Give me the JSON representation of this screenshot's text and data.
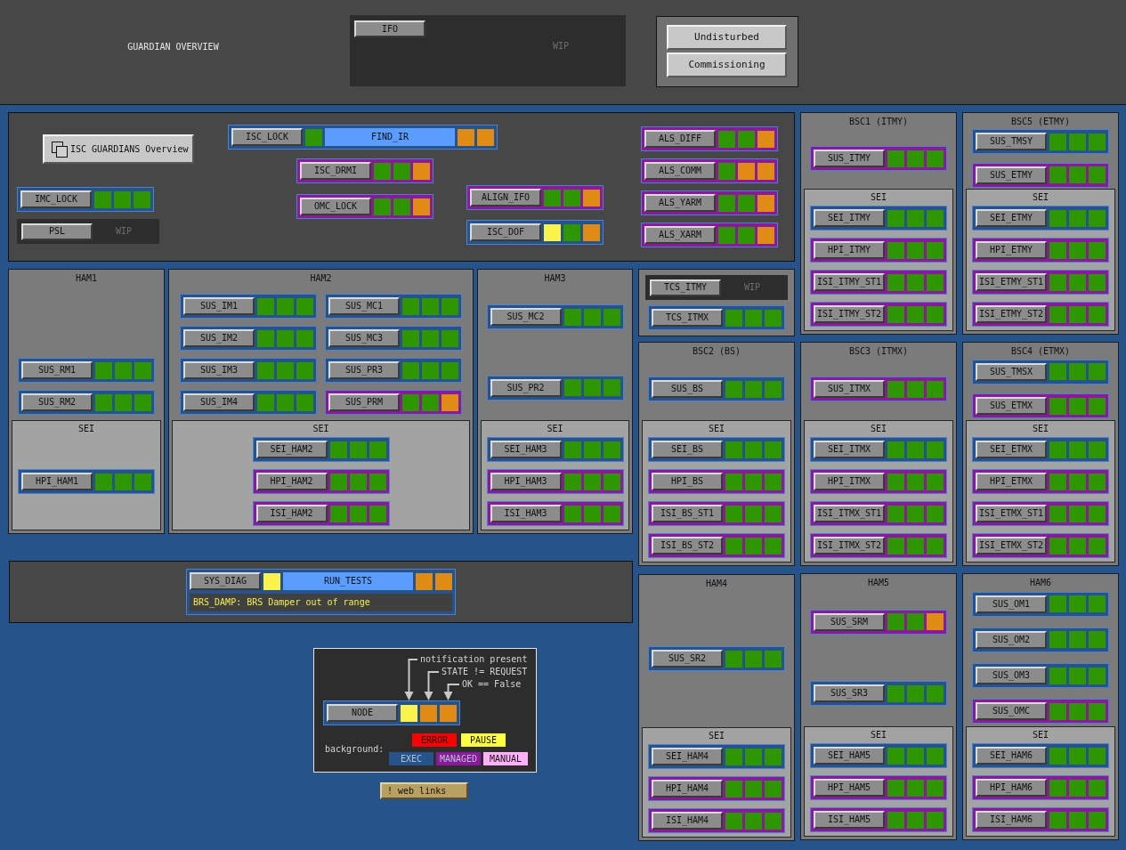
{
  "header": {
    "title": "GUARDIAN OVERVIEW",
    "ifo": {
      "kind": "wip",
      "name": "IFO",
      "note": "WIP"
    },
    "mode_buttons": [
      "Undisturbed",
      "Commissioning"
    ]
  },
  "isc": {
    "overview_button": "ISC GUARDIANS Overview",
    "groups": [
      {
        "nodes": [
          {
            "kind": "node",
            "name": "IMC_LOCK",
            "managed": false,
            "notification": false,
            "state_mismatch": false,
            "not_ok": false
          },
          {
            "kind": "wip",
            "name": "PSL",
            "note": "WIP"
          }
        ]
      },
      {
        "nodes": [
          {
            "kind": "node",
            "name": "ISC_LOCK",
            "managed": false,
            "notification": false,
            "state": "FIND_IR",
            "state_mismatch": true,
            "not_ok": true
          }
        ]
      },
      {
        "nodes": [
          {
            "kind": "node",
            "name": "ISC_DRMI",
            "managed": true,
            "notification": false,
            "state_mismatch": false,
            "not_ok": true
          },
          {
            "kind": "node",
            "name": "OMC_LOCK",
            "managed": true,
            "notification": false,
            "state_mismatch": false,
            "not_ok": true
          }
        ]
      },
      {
        "nodes": [
          {
            "kind": "node",
            "name": "ALIGN_IFO",
            "managed": true,
            "notification": false,
            "state_mismatch": false,
            "not_ok": true
          },
          {
            "kind": "node",
            "name": "ISC_DOF",
            "managed": false,
            "notification": true,
            "state_mismatch": false,
            "not_ok": true
          }
        ]
      },
      {
        "nodes": [
          {
            "kind": "node",
            "name": "ALS_DIFF",
            "managed": true,
            "notification": false,
            "state_mismatch": false,
            "not_ok": true
          },
          {
            "kind": "node",
            "name": "ALS_COMM",
            "managed": true,
            "notification": false,
            "state_mismatch": true,
            "not_ok": true
          },
          {
            "kind": "node",
            "name": "ALS_YARM",
            "managed": true,
            "notification": false,
            "state_mismatch": false,
            "not_ok": true
          },
          {
            "kind": "node",
            "name": "ALS_XARM",
            "managed": true,
            "notification": false,
            "state_mismatch": false,
            "not_ok": true
          }
        ]
      }
    ]
  },
  "chambers_ham": [
    {
      "title": "HAM1",
      "nodes": [
        {
          "kind": "node",
          "name": "SUS_RM1",
          "managed": false,
          "notification": false,
          "state_mismatch": false,
          "not_ok": false
        },
        {
          "kind": "node",
          "name": "SUS_RM2",
          "managed": false,
          "notification": false,
          "state_mismatch": false,
          "not_ok": false
        }
      ],
      "sei": {
        "title": "SEI",
        "nodes": [
          {
            "kind": "node",
            "name": "HPI_HAM1",
            "managed": false,
            "notification": false,
            "state_mismatch": false,
            "not_ok": false
          }
        ]
      }
    },
    {
      "title": "HAM2",
      "nodes": [
        {
          "kind": "node",
          "name": "SUS_IM1",
          "managed": false,
          "notification": false,
          "state_mismatch": false,
          "not_ok": false
        },
        {
          "kind": "node",
          "name": "SUS_MC1",
          "managed": false,
          "notification": false,
          "state_mismatch": false,
          "not_ok": false
        },
        {
          "kind": "node",
          "name": "SUS_IM2",
          "managed": false,
          "notification": false,
          "state_mismatch": false,
          "not_ok": false
        },
        {
          "kind": "node",
          "name": "SUS_MC3",
          "managed": false,
          "notification": false,
          "state_mismatch": false,
          "not_ok": false
        },
        {
          "kind": "node",
          "name": "SUS_IM3",
          "managed": false,
          "notification": false,
          "state_mismatch": false,
          "not_ok": false
        },
        {
          "kind": "node",
          "name": "SUS_PR3",
          "managed": false,
          "notification": false,
          "state_mismatch": false,
          "not_ok": false
        },
        {
          "kind": "node",
          "name": "SUS_IM4",
          "managed": false,
          "notification": false,
          "state_mismatch": false,
          "not_ok": false
        },
        {
          "kind": "node",
          "name": "SUS_PRM",
          "managed": true,
          "notification": false,
          "state_mismatch": false,
          "not_ok": true
        }
      ],
      "sei": {
        "title": "SEI",
        "nodes": [
          {
            "kind": "node",
            "name": "SEI_HAM2",
            "managed": false,
            "notification": false,
            "state_mismatch": false,
            "not_ok": false
          },
          {
            "kind": "node",
            "name": "HPI_HAM2",
            "managed": true,
            "notification": false,
            "state_mismatch": false,
            "not_ok": false
          },
          {
            "kind": "node",
            "name": "ISI_HAM2",
            "managed": true,
            "notification": false,
            "state_mismatch": false,
            "not_ok": false
          }
        ]
      }
    },
    {
      "title": "HAM3",
      "nodes": [
        {
          "kind": "node",
          "name": "SUS_MC2",
          "managed": false,
          "notification": false,
          "state_mismatch": false,
          "not_ok": false
        },
        {
          "kind": "node",
          "name": "SUS_PR2",
          "managed": false,
          "notification": false,
          "state_mismatch": false,
          "not_ok": false
        }
      ],
      "sei": {
        "title": "SEI",
        "nodes": [
          {
            "kind": "node",
            "name": "SEI_HAM3",
            "managed": false,
            "notification": false,
            "state_mismatch": false,
            "not_ok": false
          },
          {
            "kind": "node",
            "name": "HPI_HAM3",
            "managed": true,
            "notification": false,
            "state_mismatch": false,
            "not_ok": false
          },
          {
            "kind": "node",
            "name": "ISI_HAM3",
            "managed": true,
            "notification": false,
            "state_mismatch": false,
            "not_ok": false
          }
        ]
      }
    }
  ],
  "sys_diag": {
    "kind": "node",
    "name": "SYS_DIAG",
    "managed": false,
    "notification": true,
    "state": "RUN_TESTS",
    "state_mismatch": true,
    "not_ok": true,
    "message": "BRS_DAMP: BRS Damper out of range"
  },
  "legend": {
    "notes": [
      "notification present",
      "STATE != REQUEST",
      "OK == False"
    ],
    "node": {
      "kind": "node",
      "name": "NODE",
      "managed": false,
      "notification": true,
      "state_mismatch": true,
      "not_ok": true
    },
    "background_label": "background:",
    "swatch_rows": [
      [
        {
          "label": "ERROR",
          "color": "#ff0000"
        },
        {
          "label": "PAUSE",
          "color": "#ffff44"
        }
      ],
      [
        {
          "label": "EXEC",
          "color": "#26538a"
        },
        {
          "label": "MANAGED",
          "color": "#8a1a9a"
        },
        {
          "label": "MANUAL",
          "color": "#ffb0f8"
        }
      ]
    ]
  },
  "web_links_button": "! web links",
  "tcs": {
    "nodes": [
      {
        "kind": "wip",
        "name": "TCS_ITMY",
        "note": "WIP"
      },
      {
        "kind": "node",
        "name": "TCS_ITMX",
        "managed": false,
        "notification": false,
        "state_mismatch": false,
        "not_ok": false
      }
    ]
  },
  "chambers_column": [
    {
      "title": "BSC2 (BS)",
      "nodes": [
        {
          "kind": "node",
          "name": "SUS_BS",
          "managed": false,
          "notification": false,
          "state_mismatch": false,
          "not_ok": false
        }
      ],
      "sei": {
        "title": "SEI",
        "nodes": [
          {
            "kind": "node",
            "name": "SEI_BS",
            "managed": false,
            "notification": false,
            "state_mismatch": false,
            "not_ok": false
          },
          {
            "kind": "node",
            "name": "HPI_BS",
            "managed": true,
            "notification": false,
            "state_mismatch": false,
            "not_ok": false
          },
          {
            "kind": "node",
            "name": "ISI_BS_ST1",
            "managed": true,
            "notification": false,
            "state_mismatch": false,
            "not_ok": false
          },
          {
            "kind": "node",
            "name": "ISI_BS_ST2",
            "managed": true,
            "notification": false,
            "state_mismatch": false,
            "not_ok": false
          }
        ]
      }
    },
    {
      "title": "HAM4",
      "nodes": [
        {
          "kind": "node",
          "name": "SUS_SR2",
          "managed": false,
          "notification": false,
          "state_mismatch": false,
          "not_ok": false
        }
      ],
      "sei": {
        "title": "SEI",
        "nodes": [
          {
            "kind": "node",
            "name": "SEI_HAM4",
            "managed": false,
            "notification": false,
            "state_mismatch": false,
            "not_ok": false
          },
          {
            "kind": "node",
            "name": "HPI_HAM4",
            "managed": true,
            "notification": false,
            "state_mismatch": false,
            "not_ok": false
          },
          {
            "kind": "node",
            "name": "ISI_HAM4",
            "managed": true,
            "notification": false,
            "state_mismatch": false,
            "not_ok": false
          }
        ]
      }
    }
  ],
  "chambers_grid": [
    {
      "title": "BSC1 (ITMY)",
      "nodes": [
        {
          "kind": "node",
          "name": "SUS_ITMY",
          "managed": true,
          "notification": false,
          "state_mismatch": false,
          "not_ok": false
        }
      ],
      "sei": {
        "title": "SEI",
        "nodes": [
          {
            "kind": "node",
            "name": "SEI_ITMY",
            "managed": false,
            "notification": false,
            "state_mismatch": false,
            "not_ok": false
          },
          {
            "kind": "node",
            "name": "HPI_ITMY",
            "managed": true,
            "notification": false,
            "state_mismatch": false,
            "not_ok": false
          },
          {
            "kind": "node",
            "name": "ISI_ITMY_ST1",
            "managed": true,
            "notification": false,
            "state_mismatch": false,
            "not_ok": false
          },
          {
            "kind": "node",
            "name": "ISI_ITMY_ST2",
            "managed": true,
            "notification": false,
            "state_mismatch": false,
            "not_ok": false
          }
        ]
      }
    },
    {
      "title": "BSC5 (ETMY)",
      "nodes": [
        {
          "kind": "node",
          "name": "SUS_TMSY",
          "managed": false,
          "notification": false,
          "state_mismatch": false,
          "not_ok": false
        },
        {
          "kind": "node",
          "name": "SUS_ETMY",
          "managed": true,
          "notification": false,
          "state_mismatch": false,
          "not_ok": false
        }
      ],
      "sei": {
        "title": "SEI",
        "nodes": [
          {
            "kind": "node",
            "name": "SEI_ETMY",
            "managed": false,
            "notification": false,
            "state_mismatch": false,
            "not_ok": false
          },
          {
            "kind": "node",
            "name": "HPI_ETMY",
            "managed": true,
            "notification": false,
            "state_mismatch": false,
            "not_ok": false
          },
          {
            "kind": "node",
            "name": "ISI_ETMY_ST1",
            "managed": true,
            "notification": false,
            "state_mismatch": false,
            "not_ok": false
          },
          {
            "kind": "node",
            "name": "ISI_ETMY_ST2",
            "managed": true,
            "notification": false,
            "state_mismatch": false,
            "not_ok": false
          }
        ]
      }
    },
    {
      "title": "BSC3 (ITMX)",
      "nodes": [
        {
          "kind": "node",
          "name": "SUS_ITMX",
          "managed": true,
          "notification": false,
          "state_mismatch": false,
          "not_ok": false
        }
      ],
      "sei": {
        "title": "SEI",
        "nodes": [
          {
            "kind": "node",
            "name": "SEI_ITMX",
            "managed": false,
            "notification": false,
            "state_mismatch": false,
            "not_ok": false
          },
          {
            "kind": "node",
            "name": "HPI_ITMX",
            "managed": true,
            "notification": false,
            "state_mismatch": false,
            "not_ok": false
          },
          {
            "kind": "node",
            "name": "ISI_ITMX_ST1",
            "managed": true,
            "notification": false,
            "state_mismatch": false,
            "not_ok": false
          },
          {
            "kind": "node",
            "name": "ISI_ITMX_ST2",
            "managed": true,
            "notification": false,
            "state_mismatch": false,
            "not_ok": false
          }
        ]
      }
    },
    {
      "title": "BSC4 (ETMX)",
      "nodes": [
        {
          "kind": "node",
          "name": "SUS_TMSX",
          "managed": false,
          "notification": false,
          "state_mismatch": false,
          "not_ok": false
        },
        {
          "kind": "node",
          "name": "SUS_ETMX",
          "managed": true,
          "notification": false,
          "state_mismatch": false,
          "not_ok": false
        }
      ],
      "sei": {
        "title": "SEI",
        "nodes": [
          {
            "kind": "node",
            "name": "SEI_ETMX",
            "managed": false,
            "notification": false,
            "state_mismatch": false,
            "not_ok": false
          },
          {
            "kind": "node",
            "name": "HPI_ETMX",
            "managed": true,
            "notification": false,
            "state_mismatch": false,
            "not_ok": false
          },
          {
            "kind": "node",
            "name": "ISI_ETMX_ST1",
            "managed": true,
            "notification": false,
            "state_mismatch": false,
            "not_ok": false
          },
          {
            "kind": "node",
            "name": "ISI_ETMX_ST2",
            "managed": true,
            "notification": false,
            "state_mismatch": false,
            "not_ok": false
          }
        ]
      }
    },
    {
      "title": "HAM5",
      "nodes": [
        {
          "kind": "node",
          "name": "SUS_SRM",
          "managed": true,
          "notification": false,
          "state_mismatch": false,
          "not_ok": true
        },
        {
          "kind": "node",
          "name": "SUS_SR3",
          "managed": false,
          "notification": false,
          "state_mismatch": false,
          "not_ok": false
        }
      ],
      "sei": {
        "title": "SEI",
        "nodes": [
          {
            "kind": "node",
            "name": "SEI_HAM5",
            "managed": false,
            "notification": false,
            "state_mismatch": false,
            "not_ok": false
          },
          {
            "kind": "node",
            "name": "HPI_HAM5",
            "managed": true,
            "notification": false,
            "state_mismatch": false,
            "not_ok": false
          },
          {
            "kind": "node",
            "name": "ISI_HAM5",
            "managed": true,
            "notification": false,
            "state_mismatch": false,
            "not_ok": false
          }
        ]
      }
    },
    {
      "title": "HAM6",
      "nodes": [
        {
          "kind": "node",
          "name": "SUS_OM1",
          "managed": false,
          "notification": false,
          "state_mismatch": false,
          "not_ok": false
        },
        {
          "kind": "node",
          "name": "SUS_OM2",
          "managed": false,
          "notification": false,
          "state_mismatch": false,
          "not_ok": false
        },
        {
          "kind": "node",
          "name": "SUS_OM3",
          "managed": false,
          "notification": false,
          "state_mismatch": false,
          "not_ok": false
        },
        {
          "kind": "node",
          "name": "SUS_OMC",
          "managed": true,
          "notification": false,
          "state_mismatch": false,
          "not_ok": false
        }
      ],
      "sei": {
        "title": "SEI",
        "nodes": [
          {
            "kind": "node",
            "name": "SEI_HAM6",
            "managed": false,
            "notification": false,
            "state_mismatch": false,
            "not_ok": false
          },
          {
            "kind": "node",
            "name": "HPI_HAM6",
            "managed": true,
            "notification": false,
            "state_mismatch": false,
            "not_ok": false
          },
          {
            "kind": "node",
            "name": "ISI_HAM6",
            "managed": true,
            "notification": false,
            "state_mismatch": false,
            "not_ok": false
          }
        ]
      }
    }
  ]
}
